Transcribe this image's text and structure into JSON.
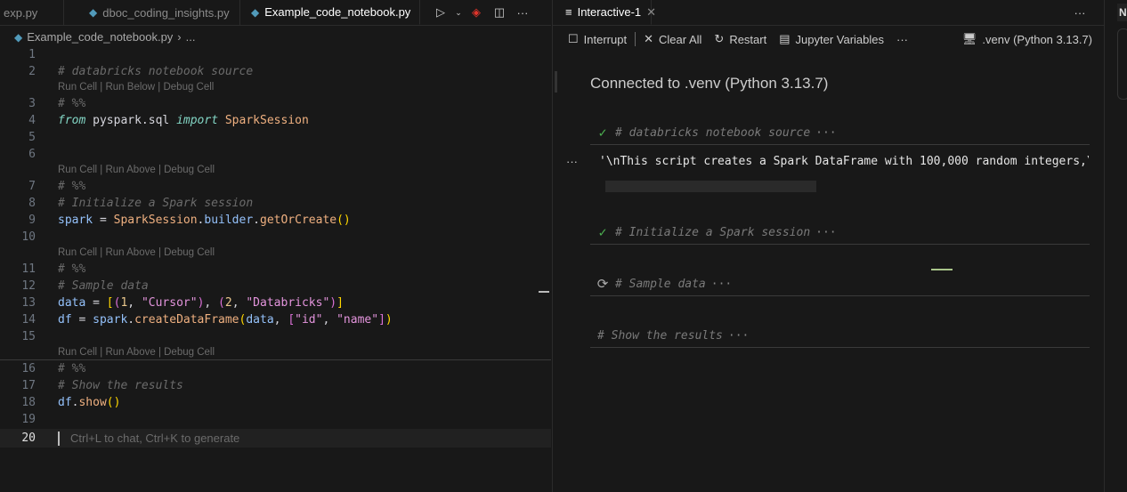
{
  "editor": {
    "tabs": [
      {
        "label": "exp.py",
        "active": false
      },
      {
        "label": "dboc_coding_insights.py",
        "active": false
      },
      {
        "label": "Example_code_notebook.py",
        "active": true,
        "modified": true
      }
    ],
    "breadcrumb": {
      "file": "Example_code_notebook.py",
      "rest": "..."
    },
    "lines": [
      {
        "n": "1",
        "tokens": []
      },
      {
        "n": "2",
        "tokens": [
          [
            "# databricks notebook source",
            "c"
          ]
        ]
      },
      {
        "lens": "Run Cell | Run Below | Debug Cell"
      },
      {
        "n": "3",
        "tokens": [
          [
            "# %%",
            "c"
          ]
        ]
      },
      {
        "n": "4",
        "tokens": [
          [
            "from",
            "k"
          ],
          [
            " pyspark.sql ",
            "p"
          ],
          [
            "import",
            "k"
          ],
          [
            " ",
            "p"
          ],
          [
            "SparkSession",
            "cl"
          ]
        ]
      },
      {
        "n": "5",
        "tokens": []
      },
      {
        "n": "6",
        "tokens": []
      },
      {
        "lens": "Run Cell | Run Above | Debug Cell"
      },
      {
        "n": "7",
        "tokens": [
          [
            "# %%",
            "c"
          ]
        ]
      },
      {
        "n": "8",
        "tokens": [
          [
            "# Initialize a Spark session",
            "c"
          ]
        ]
      },
      {
        "n": "9",
        "tokens": [
          [
            "spark",
            "v"
          ],
          [
            " = ",
            "p"
          ],
          [
            "SparkSession",
            "cl"
          ],
          [
            ".",
            "p"
          ],
          [
            "builder",
            "v"
          ],
          [
            ".",
            "p"
          ],
          [
            "getOrCreate",
            "f"
          ],
          [
            "()",
            "b1"
          ]
        ]
      },
      {
        "n": "10",
        "tokens": []
      },
      {
        "lens": "Run Cell | Run Above | Debug Cell"
      },
      {
        "n": "11",
        "tokens": [
          [
            "# %%",
            "c"
          ]
        ]
      },
      {
        "n": "12",
        "tokens": [
          [
            "# Sample data",
            "c"
          ]
        ]
      },
      {
        "n": "13",
        "tokens": [
          [
            "data",
            "v"
          ],
          [
            " = ",
            "p"
          ],
          [
            "[",
            "b1"
          ],
          [
            "(",
            "b2"
          ],
          [
            "1",
            "n"
          ],
          [
            ", ",
            "p"
          ],
          [
            "\"Cursor\"",
            "s"
          ],
          [
            ")",
            "b2"
          ],
          [
            ", ",
            "p"
          ],
          [
            "(",
            "b2"
          ],
          [
            "2",
            "n"
          ],
          [
            ", ",
            "p"
          ],
          [
            "\"Databricks\"",
            "s"
          ],
          [
            ")",
            "b2"
          ],
          [
            "]",
            "b1"
          ]
        ]
      },
      {
        "n": "14",
        "tokens": [
          [
            "df",
            "v"
          ],
          [
            " = ",
            "p"
          ],
          [
            "spark",
            "v"
          ],
          [
            ".",
            "p"
          ],
          [
            "createDataFrame",
            "f"
          ],
          [
            "(",
            "b1"
          ],
          [
            "data",
            "v"
          ],
          [
            ", ",
            "p"
          ],
          [
            "[",
            "b2"
          ],
          [
            "\"id\"",
            "s"
          ],
          [
            ", ",
            "p"
          ],
          [
            "\"name\"",
            "s"
          ],
          [
            "]",
            "b2"
          ],
          [
            ")",
            "b1"
          ]
        ]
      },
      {
        "n": "15",
        "tokens": []
      },
      {
        "lens": "Run Cell | Run Above | Debug Cell",
        "sep": true
      },
      {
        "n": "16",
        "tokens": [
          [
            "# %%",
            "c"
          ]
        ]
      },
      {
        "n": "17",
        "tokens": [
          [
            "# Show the results",
            "c"
          ]
        ]
      },
      {
        "n": "18",
        "tokens": [
          [
            "df",
            "v"
          ],
          [
            ".",
            "p"
          ],
          [
            "show",
            "f"
          ],
          [
            "()",
            "b1"
          ]
        ]
      },
      {
        "n": "19",
        "tokens": []
      },
      {
        "n": "20",
        "current": true,
        "hint": "Ctrl+L to chat, Ctrl+K to generate"
      }
    ]
  },
  "interactive": {
    "tab": "Interactive-1",
    "toolbar": {
      "interrupt": "Interrupt",
      "clear_all": "Clear All",
      "restart": "Restart",
      "variables": "Jupyter Variables",
      "kernel": ".venv (Python 3.13.7)"
    },
    "connected": "Connected to .venv (Python 3.13.7)",
    "cells": [
      {
        "title": "# databricks notebook source",
        "status": "success"
      },
      {
        "title": "# Initialize a Spark session",
        "status": "success"
      },
      {
        "title": "# Sample data",
        "status": "running"
      },
      {
        "title": "# Show the results",
        "status": "pending"
      }
    ],
    "output": "'\\nThis script creates a Spark DataFrame with 100,000 random integers,\\n"
  },
  "far_panel": {
    "label": "N"
  },
  "colors": {
    "success": "#4caf50",
    "comment": "#6b6b6b",
    "keyword": "#83d6c5",
    "string": "#e394dc"
  }
}
